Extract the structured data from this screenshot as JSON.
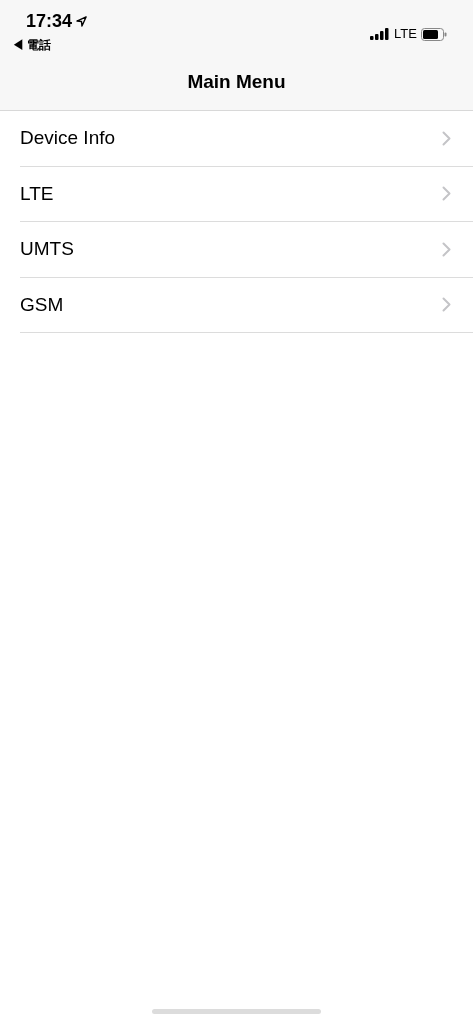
{
  "status_bar": {
    "time": "17:34",
    "back_app": "◀ 電話",
    "network": "LTE"
  },
  "nav_bar": {
    "title": "Main Menu"
  },
  "menu_items": [
    {
      "label": "Device Info"
    },
    {
      "label": "LTE"
    },
    {
      "label": "UMTS"
    },
    {
      "label": "GSM"
    }
  ]
}
